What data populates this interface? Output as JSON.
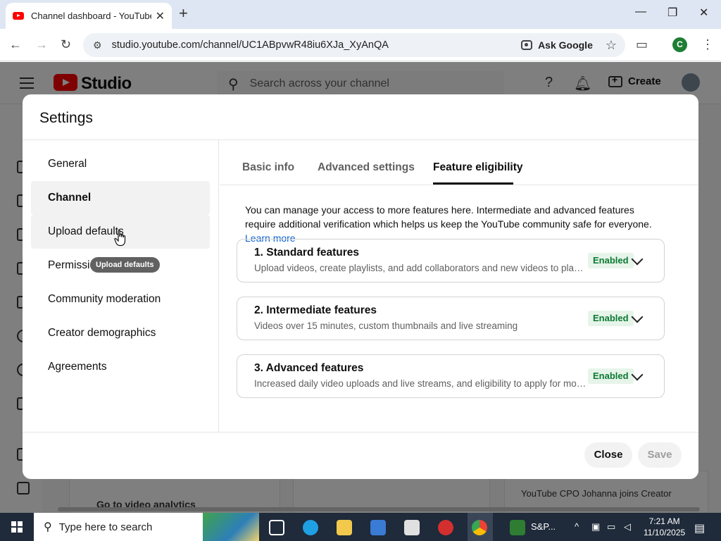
{
  "browser": {
    "tab_title": "Channel dashboard - YouTube S",
    "tab_close": "✕",
    "new_tab": "+",
    "url": "studio.youtube.com/channel/UC1ABpvwR48iu6XJa_XyAnQA",
    "ask_google": "Ask Google",
    "profile_initial": "C",
    "icons": {
      "back": "←",
      "forward": "→",
      "reload": "↻",
      "tune": "⚙",
      "star": "☆",
      "cast": "▭",
      "menu": "⋮",
      "minimize": "—",
      "maximize": "❐",
      "close": "✕"
    }
  },
  "studio": {
    "logo_text": "Studio",
    "search_placeholder": "Search across your channel",
    "create_label": "Create",
    "bg_link": "Go to video analytics",
    "bg_news": "YouTube CPO Johanna joins Creator"
  },
  "dialog": {
    "title": "Settings",
    "nav": [
      {
        "label": "General"
      },
      {
        "label": "Channel"
      },
      {
        "label": "Upload defaults"
      },
      {
        "label": "Permissions"
      },
      {
        "label": "Community moderation"
      },
      {
        "label": "Creator demographics"
      },
      {
        "label": "Agreements"
      }
    ],
    "tooltip": "Upload defaults",
    "tabs": [
      {
        "label": "Basic info"
      },
      {
        "label": "Advanced settings"
      },
      {
        "label": "Feature eligibility"
      }
    ],
    "intro_text": "You can manage your access to more features here. Intermediate and advanced features require additional verification which helps us keep the YouTube community safe for everyone. ",
    "learn_more": "Learn more",
    "features": [
      {
        "title": "1. Standard features",
        "desc": "Upload videos, create playlists, and add collaborators and new videos to playlists",
        "status": "Enabled"
      },
      {
        "title": "2. Intermediate features",
        "desc": "Videos over 15 minutes, custom thumbnails and live streaming",
        "status": "Enabled"
      },
      {
        "title": "3. Advanced features",
        "desc": "Increased daily video uploads and live streams, and eligibility to apply for monetization",
        "status": "Enabled"
      }
    ],
    "close_label": "Close",
    "save_label": "Save"
  },
  "taskbar": {
    "search_placeholder": "Type here to search",
    "sp_label": "S&P...",
    "time": "7:21 AM",
    "date": "11/10/2025"
  },
  "colors": {
    "accent_link": "#065fd4",
    "enabled_green": "#0b7a31",
    "enabled_bg": "#e6f4ea",
    "youtube_red": "#ff0000"
  }
}
